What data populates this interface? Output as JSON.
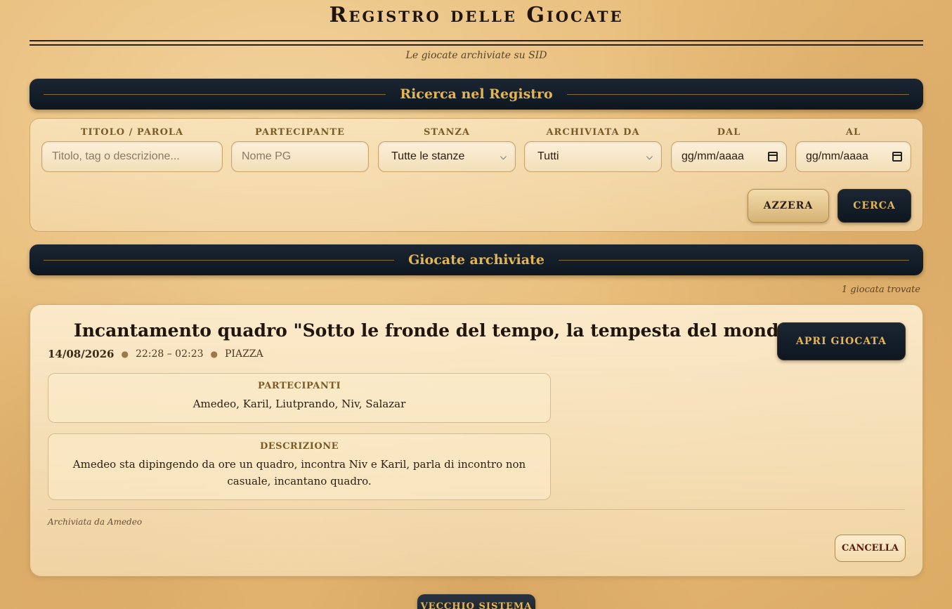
{
  "header": {
    "title": "Registro delle Giocate",
    "subtitle": "Le giocate archiviate su SID"
  },
  "search": {
    "section_title": "Ricerca nel Registro",
    "fields": {
      "title_label": "TITOLO / PAROLA",
      "title_placeholder": "Titolo, tag o descrizione...",
      "participant_label": "PARTECIPANTE",
      "participant_placeholder": "Nome PG",
      "room_label": "STANZA",
      "room_value": "Tutte le stanze",
      "archived_label": "ARCHIVIATA DA",
      "archived_value": "Tutti",
      "from_label": "DAL",
      "from_value": "gg/mm/aaaa",
      "to_label": "AL",
      "to_value": "gg/mm/aaaa"
    },
    "reset_label": "AZZERA",
    "search_label": "CERCA"
  },
  "results": {
    "section_title": "Giocate archiviate",
    "count_text": "1 giocata trovate",
    "items": [
      {
        "title": "Incantamento quadro \"Sotto le fronde del tempo, la tempesta del mondo\"",
        "date": "14/08/2026",
        "time": "22:28 – 02:23",
        "room": "PIAZZA",
        "open_label": "APRI GIOCATA",
        "participants_label": "PARTECIPANTI",
        "participants": "Amedeo, Karil, Liutprando, Niv, Salazar",
        "description_label": "DESCRIZIONE",
        "description": "Amedeo sta dipingendo da ore un quadro, incontra Niv e Karil, parla di incontro non casuale, incantano quadro.",
        "archived_by": "Archiviata da Amedeo",
        "delete_label": "CANCELLA"
      }
    ]
  },
  "footer": {
    "old_system_label": "VECCHIO SISTEMA"
  },
  "colors": {
    "accent_gold": "#e6b450",
    "bar_navy": "#0e1720",
    "parchment": "#f1d29c"
  },
  "icons": {
    "select_chevron": "chevron-down-icon",
    "date_picker": "calendar-icon"
  }
}
